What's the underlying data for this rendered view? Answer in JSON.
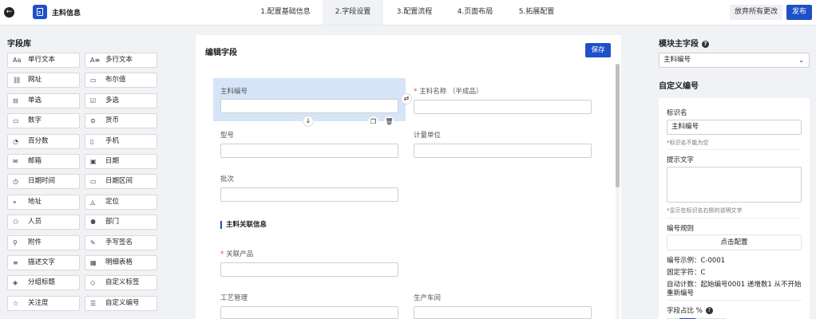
{
  "header": {
    "app_title": "主料信息",
    "steps": [
      "1.配置基础信息",
      "2.字段设置",
      "3.配置流程",
      "4.页面布局",
      "5.拓展配置"
    ],
    "active_step": 1,
    "discard_label": "放弃所有更改",
    "publish_label": "发布"
  },
  "library": {
    "title": "字段库",
    "items": [
      {
        "label": "单行文本",
        "icon": "text-aa-icon",
        "glyph": "Aa"
      },
      {
        "label": "多行文本",
        "icon": "multiline-text-icon",
        "glyph": "A≡"
      },
      {
        "label": "网址",
        "icon": "link-icon",
        "glyph": "⛓"
      },
      {
        "label": "布尔值",
        "icon": "boolean-icon",
        "glyph": "▭"
      },
      {
        "label": "单选",
        "icon": "radio-icon",
        "glyph": "⊟"
      },
      {
        "label": "多选",
        "icon": "checkbox-icon",
        "glyph": "☑"
      },
      {
        "label": "数字",
        "icon": "number-icon",
        "glyph": "▭"
      },
      {
        "label": "货币",
        "icon": "currency-icon",
        "glyph": "⊜"
      },
      {
        "label": "百分数",
        "icon": "percent-icon",
        "glyph": "◔"
      },
      {
        "label": "手机",
        "icon": "phone-icon",
        "glyph": "▯"
      },
      {
        "label": "邮箱",
        "icon": "mail-icon",
        "glyph": "✉"
      },
      {
        "label": "日期",
        "icon": "calendar-icon",
        "glyph": "▣"
      },
      {
        "label": "日期时间",
        "icon": "clock-icon",
        "glyph": "◷"
      },
      {
        "label": "日期区间",
        "icon": "date-range-icon",
        "glyph": "▭"
      },
      {
        "label": "地址",
        "icon": "location-icon",
        "glyph": "⌖"
      },
      {
        "label": "定位",
        "icon": "navigation-icon",
        "glyph": "◬"
      },
      {
        "label": "人员",
        "icon": "person-icon",
        "glyph": "⚇"
      },
      {
        "label": "部门",
        "icon": "department-icon",
        "glyph": "⚉"
      },
      {
        "label": "附件",
        "icon": "attachment-icon",
        "glyph": "⚲"
      },
      {
        "label": "手写签名",
        "icon": "signature-icon",
        "glyph": "✎"
      },
      {
        "label": "描述文字",
        "icon": "description-icon",
        "glyph": "≡"
      },
      {
        "label": "明细表格",
        "icon": "table-icon",
        "glyph": "▦"
      },
      {
        "label": "分组标题",
        "icon": "layers-icon",
        "glyph": "◈"
      },
      {
        "label": "自定义标签",
        "icon": "tag-icon",
        "glyph": "◇"
      },
      {
        "label": "关注度",
        "icon": "star-icon",
        "glyph": "☆"
      },
      {
        "label": "自定义编号",
        "icon": "list-number-icon",
        "glyph": "☰"
      }
    ]
  },
  "editor": {
    "title": "编辑字段",
    "save_label": "保存",
    "fields": [
      {
        "label": "主料编号",
        "required": false
      },
      {
        "label": "主料名称 （半成品）",
        "required": true
      },
      {
        "label": "型号",
        "required": false
      },
      {
        "label": "计量单位",
        "required": false
      },
      {
        "label": "批次",
        "required": false
      },
      {
        "label": "关联产品",
        "required": true
      },
      {
        "label": "工艺管理",
        "required": false
      },
      {
        "label": "生产车间",
        "required": false
      }
    ],
    "section_title": "主料关联信息",
    "required_mark": "*"
  },
  "right_panel": {
    "module_title": "模块主字段",
    "module_value": "主料编号",
    "custom_title": "自定义编号",
    "name_label": "标识名",
    "name_value": "主料编号",
    "name_hint": "*标识名不能为空",
    "prompt_label": "提示文字",
    "prompt_hint": "*显示在标识名右侧的说明文字",
    "rule_label": "编号规则",
    "config_button": "点击配置",
    "example": "编号示例：C-0001",
    "fixed": "固定字符：C",
    "auto_count_1": "自动计数：起始编号0001 递增数1 从不开始",
    "auto_count_2": "重新编号",
    "ratio_label": "字段占比 %"
  },
  "colors": {
    "accent": "#1e50c8",
    "selected_field_bg": "#d6e4f8",
    "required": "#e64a3c"
  }
}
